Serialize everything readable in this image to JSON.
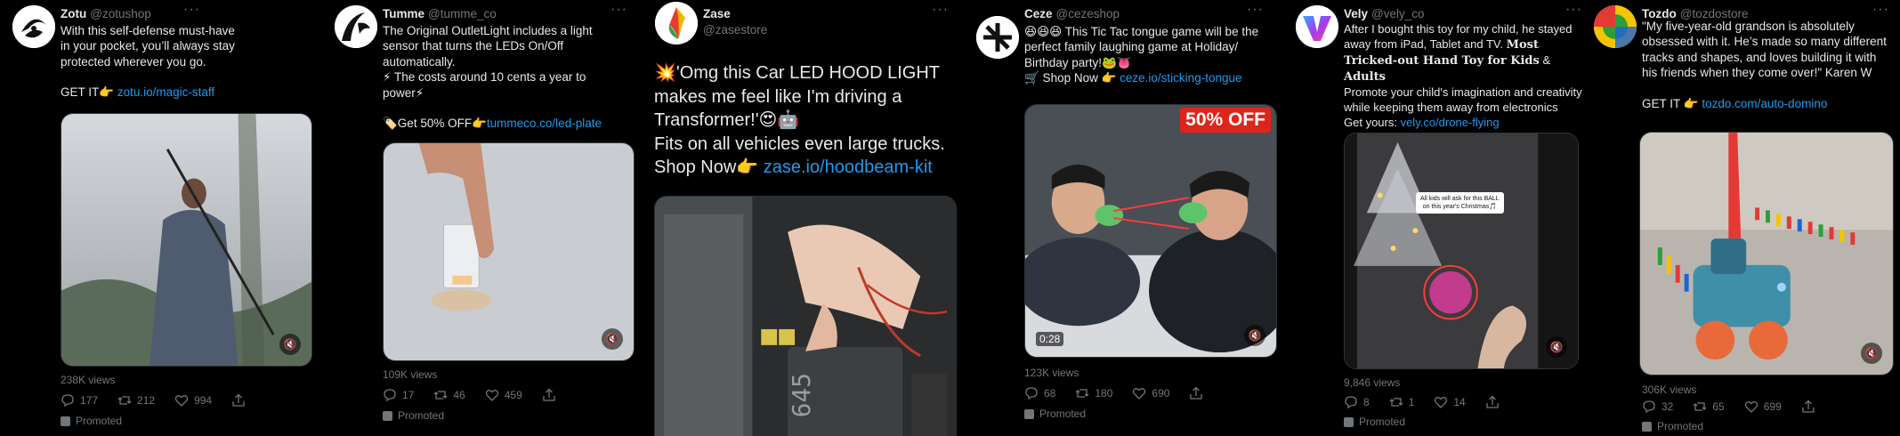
{
  "tweets": [
    {
      "name": "Zotu",
      "handle": "@zotushop",
      "text1": "With this self-defense must-have in your pocket, you’ll always stay protected wherever you go.",
      "cta": "GET IT👉 ",
      "link": "zotu.io/magic-staff",
      "views": "238K views",
      "replies": "177",
      "retweets": "212",
      "likes": "994",
      "promoted": "Promoted",
      "more": "···"
    },
    {
      "name": "Tumme",
      "handle": "@tumme_co",
      "text1": "The Original OutletLight includes a light sensor that turns the LEDs On/Off automatically.\n⚡ The costs around 10 cents a year to power⚡",
      "cta": "🏷️Get 50% OFF👉",
      "link": "tummeco.co/led-plate",
      "views": "109K views",
      "replies": "17",
      "retweets": "46",
      "likes": "459",
      "promoted": "Promoted",
      "more": "···"
    },
    {
      "name": "Zase",
      "handle": "@zasestore",
      "text1": "💥'Omg this Car LED HOOD LIGHT makes me feel like I'm driving a Transformer!'😍🤖\nFits on all vehicles even large trucks.",
      "cta": "Shop Now👉 ",
      "link": "zase.io/hoodbeam-kit",
      "more": "···"
    },
    {
      "name": "Ceze",
      "handle": "@cezeshop",
      "text1": "😆😆😆 This Tic Tac tongue game will be the perfect family laughing game at Holiday/ Birthday party!🐸👅",
      "cta": "🛒 Shop Now 👉 ",
      "link": "ceze.io/sticking-tongue",
      "badge": "50% OFF",
      "time": "0:28",
      "views": "123K views",
      "replies": "68",
      "retweets": "180",
      "likes": "690",
      "promoted": "Promoted",
      "more": "···"
    },
    {
      "name": "Vely",
      "handle": "@vely_co",
      "text1": "After I bought this toy for my child, he stayed away from iPad, Tablet and TV. ",
      "bold": "Most Tricked-out Hand Toy for Kids",
      "amp": " & ",
      "bold2": "Adults",
      "text2": "Promote your child's imagination and creativity while keeping them away from electronics",
      "cta": "Get yours: ",
      "link": "vely.co/drone-flying",
      "overlay": "All kids will ask for this BALL\non this year's Christmas🎵",
      "views": "9,846 views",
      "replies": "8",
      "retweets": "1",
      "likes": "14",
      "promoted": "Promoted",
      "more": "···"
    },
    {
      "name": "Tozdo",
      "handle": "@tozdostore",
      "text1": "\"My five-year-old grandson is absolutely obsessed with it. He’s made so many different tracks and shapes, and loves building it with his friends when they come over!\" Karen W",
      "cta": "GET IT 👉 ",
      "link": "tozdo.com/auto-domino",
      "views": "306K views",
      "replies": "32",
      "retweets": "65",
      "likes": "699",
      "promoted": "Promoted",
      "more": "···"
    }
  ],
  "icons": {
    "reply": "reply-icon",
    "retweet": "retweet-icon",
    "like": "like-icon",
    "share": "share-icon",
    "mute": "🔇"
  },
  "colors": {
    "background": "#000000",
    "text": "#e7e9ea",
    "muted": "#71767b",
    "link": "#1d9bf0"
  }
}
